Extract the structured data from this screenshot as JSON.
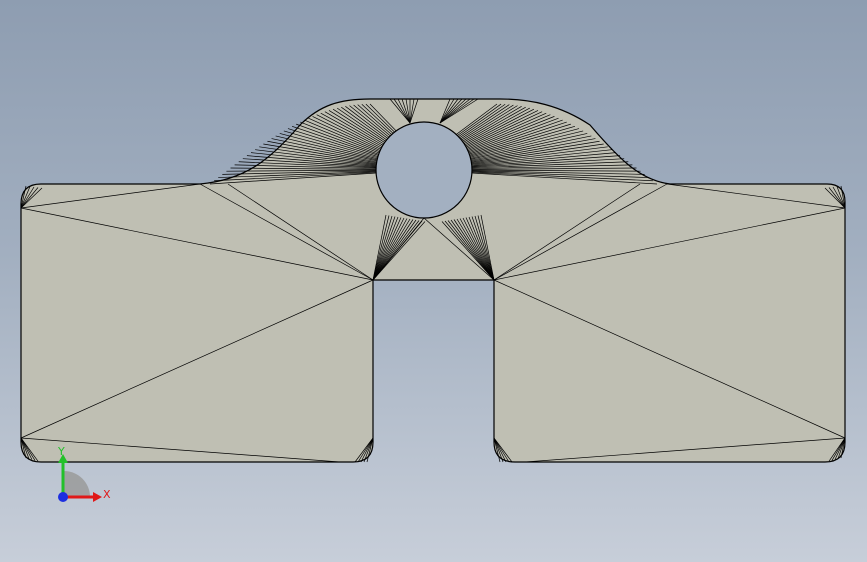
{
  "viewport": {
    "background_top": "#8e9db1",
    "background_bottom": "#c7ced9"
  },
  "part": {
    "fill": "#bfbfb3",
    "edge_color": "#000000",
    "features": [
      "mesh-triangulation",
      "through-hole",
      "center-slot",
      "rounded-corners"
    ]
  },
  "triad": {
    "x_label": "X",
    "y_label": "Y",
    "x_color": "#e01818",
    "y_color": "#22c02a",
    "z_color": "#1c2ee0"
  }
}
